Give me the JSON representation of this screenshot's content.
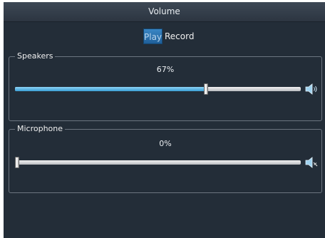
{
  "window": {
    "title": "Volume"
  },
  "tabs": [
    {
      "label": "Play",
      "selected": true
    },
    {
      "label": "Record",
      "selected": false
    }
  ],
  "speakers": {
    "group_label": "Speakers",
    "level_text": "67%",
    "level": 0.67,
    "icon": "speaker-volume-icon"
  },
  "microphone": {
    "group_label": "Microphone",
    "level_text": "0%",
    "level": 0.0,
    "icon": "speaker-muted-icon"
  },
  "colors": {
    "background": "#232d38",
    "accent": "#3a9fd6",
    "tab_selected": "#1f5f9a",
    "border": "#6c7580"
  }
}
